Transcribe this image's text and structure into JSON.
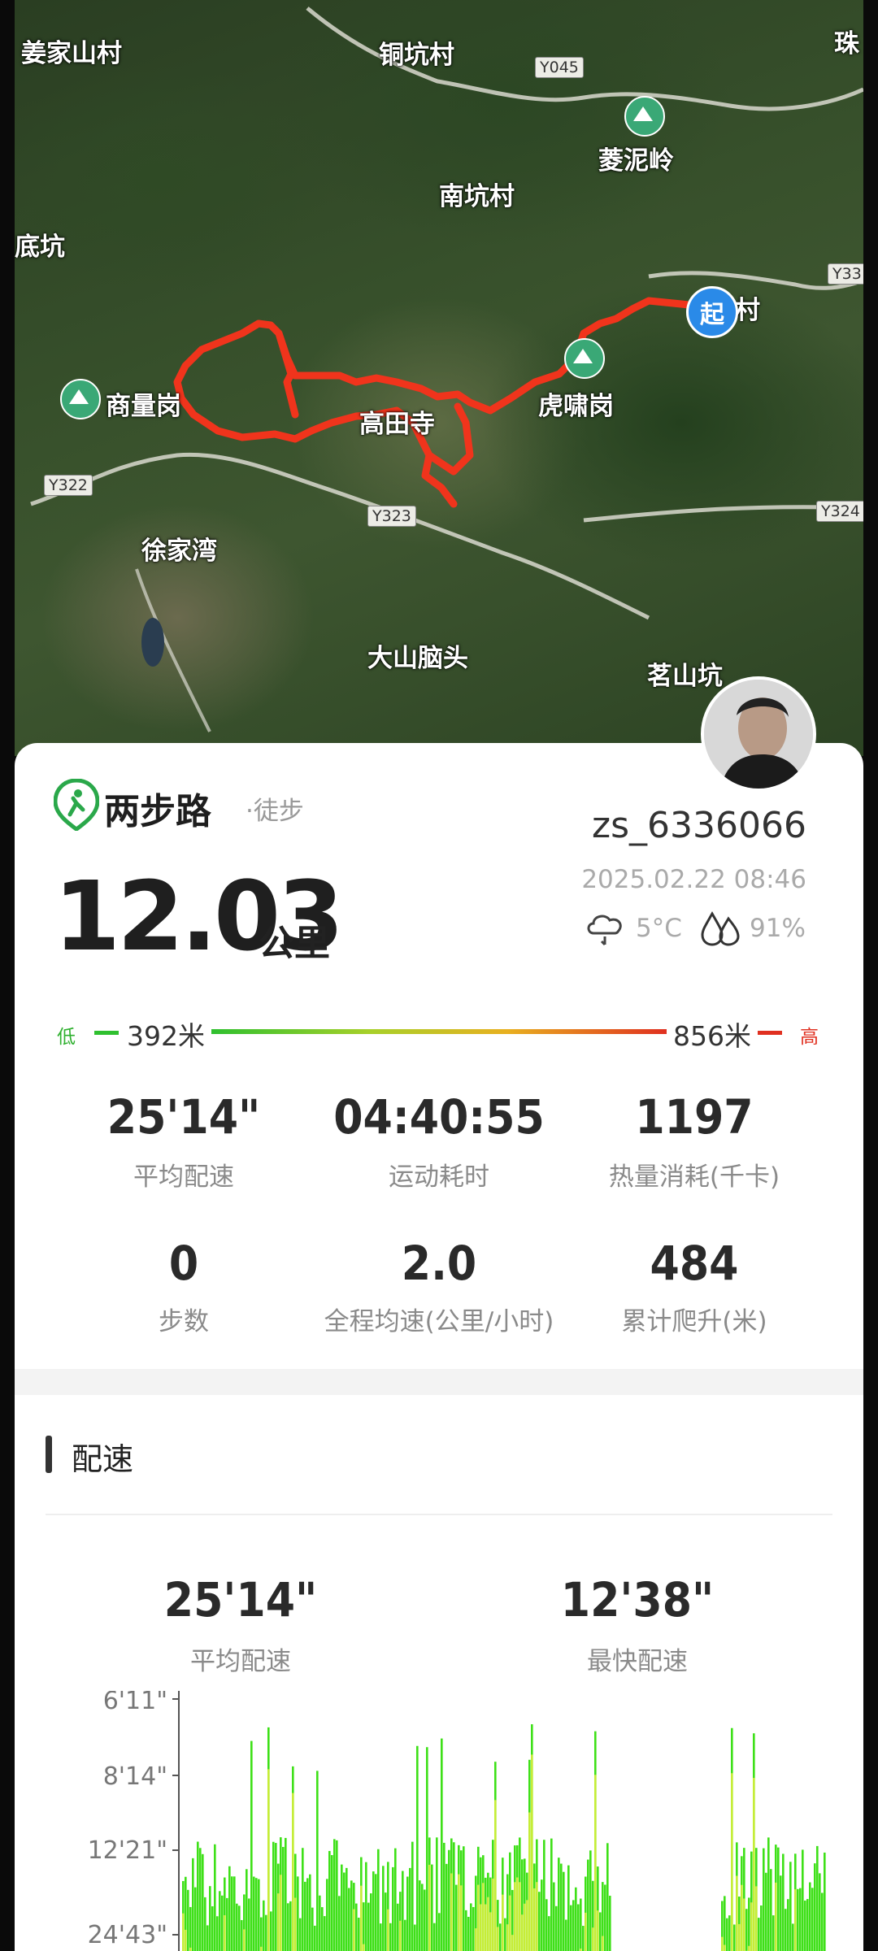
{
  "map": {
    "labels": [
      "姜家山村",
      "铜坑村",
      "珠",
      "菱泥岭",
      "南坑村",
      "底坑",
      "商量岗",
      "高田寺",
      "虎啸岗",
      "徐家湾",
      "大山脑头",
      "茗山坑"
    ],
    "road_tags": [
      "Y045",
      "Y33",
      "Y322",
      "Y323",
      "Y324"
    ],
    "start_marker": "起",
    "start_label_suffix": "村"
  },
  "header": {
    "app_name": "两步路",
    "activity": "·徒步",
    "username": "zs_6336066",
    "datetime": "2025.02.22 08:46",
    "weather_icon": "cloud-rain-icon",
    "temperature": "5°C",
    "humidity_icon": "water-drops-icon",
    "humidity": "91%"
  },
  "distance": {
    "value": "12.03",
    "unit": "公里"
  },
  "elevation": {
    "low_label": "低",
    "low_value": "392米",
    "high_value": "856米",
    "high_label": "高",
    "colors": {
      "low": "#2fc02f",
      "mid": "#e8b020",
      "high": "#e03020"
    }
  },
  "stats": [
    {
      "value": "25'14\"",
      "label": "平均配速"
    },
    {
      "value": "04:40:55",
      "label": "运动耗时"
    },
    {
      "value": "1197",
      "label": "热量消耗(千卡)"
    },
    {
      "value": "0",
      "label": "步数"
    },
    {
      "value": "2.0",
      "label": "全程均速(公里/小时)"
    },
    {
      "value": "484",
      "label": "累计爬升(米)"
    }
  ],
  "pace_section": {
    "title": "配速",
    "avg_value": "25'14\"",
    "avg_label": "平均配速",
    "best_value": "12'38\"",
    "best_label": "最快配速"
  },
  "chart_data": {
    "type": "area",
    "ytick_labels": [
      "6'11\"",
      "8'14\"",
      "12'21\"",
      "24'43\""
    ],
    "colors": {
      "fill": "#3ee018",
      "highlight": "#e8f040"
    }
  }
}
